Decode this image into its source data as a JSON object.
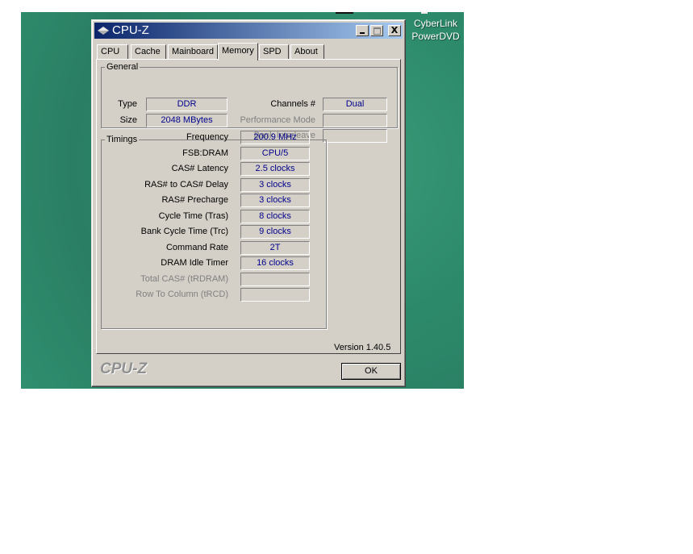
{
  "desktop": {
    "icon_label_line1": "CyberLink",
    "icon_label_line2": "PowerDVD"
  },
  "window": {
    "title": "CPU-Z",
    "min_label": "_",
    "max_label": "",
    "close_label": "X"
  },
  "tabs": [
    {
      "label": "CPU"
    },
    {
      "label": "Cache"
    },
    {
      "label": "Mainboard"
    },
    {
      "label": "Memory",
      "active": true
    },
    {
      "label": "SPD"
    },
    {
      "label": "About"
    }
  ],
  "general": {
    "legend": "General",
    "type_label": "Type",
    "type_value": "DDR",
    "size_label": "Size",
    "size_value": "2048 MBytes",
    "channels_label": "Channels #",
    "channels_value": "Dual",
    "perf_mode_label": "Performance Mode",
    "perf_mode_value": "",
    "bank_interleave_label": "Bank Interleave",
    "bank_interleave_value": ""
  },
  "timings": {
    "legend": "Timings",
    "rows": [
      {
        "label": "Frequency",
        "value": "200.9 MHz",
        "enabled": true
      },
      {
        "label": "FSB:DRAM",
        "value": "CPU/5",
        "enabled": true
      },
      {
        "label": "CAS# Latency",
        "value": "2.5 clocks",
        "enabled": true
      },
      {
        "label": "RAS# to CAS# Delay",
        "value": "3 clocks",
        "enabled": true
      },
      {
        "label": "RAS# Precharge",
        "value": "3 clocks",
        "enabled": true
      },
      {
        "label": "Cycle Time (Tras)",
        "value": "8 clocks",
        "enabled": true
      },
      {
        "label": "Bank Cycle Time (Trc)",
        "value": "9 clocks",
        "enabled": true
      },
      {
        "label": "Command Rate",
        "value": "2T",
        "enabled": true
      },
      {
        "label": "DRAM Idle Timer",
        "value": "16 clocks",
        "enabled": true
      },
      {
        "label": "Total CAS# (tRDRAM)",
        "value": "",
        "enabled": false
      },
      {
        "label": "Row To Column (tRCD)",
        "value": "",
        "enabled": false
      }
    ]
  },
  "footer": {
    "version": "Version 1.40.5",
    "brand": "CPU-Z",
    "ok_label": "OK"
  },
  "colors": {
    "title_start": "#0a246a",
    "title_end": "#a6caf0",
    "value_text": "#00008b",
    "face": "#d4d0c8"
  }
}
